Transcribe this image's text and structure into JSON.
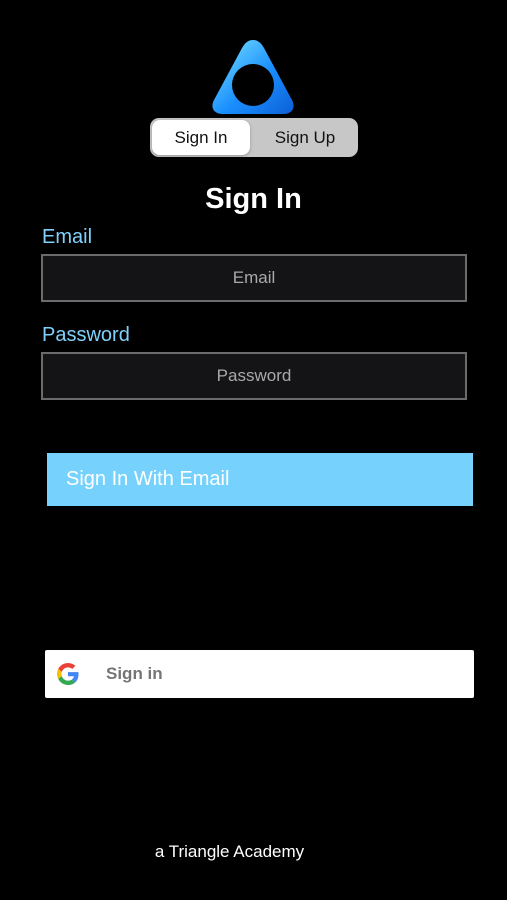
{
  "logo": {
    "icon": "triangle-logo-icon",
    "colors": [
      "#7fe6ff",
      "#1a8fff",
      "#0d5fd6"
    ]
  },
  "segmented_control": {
    "options": [
      "Sign In",
      "Sign Up"
    ],
    "selected": "Sign In"
  },
  "page_title": "Sign In",
  "form": {
    "email_label": "Email",
    "email_placeholder": "Email",
    "email_value": "",
    "password_label": "Password",
    "password_placeholder": "Password",
    "password_value": ""
  },
  "email_button_label": "Sign In With Email",
  "google_button": {
    "label": "Sign in",
    "icon": "google-g-icon"
  },
  "footer": "a Triangle Academy",
  "colors": {
    "background": "#000000",
    "accent": "#76d2fd",
    "label": "#7fd1fb",
    "field_border": "#6b6b6b"
  }
}
